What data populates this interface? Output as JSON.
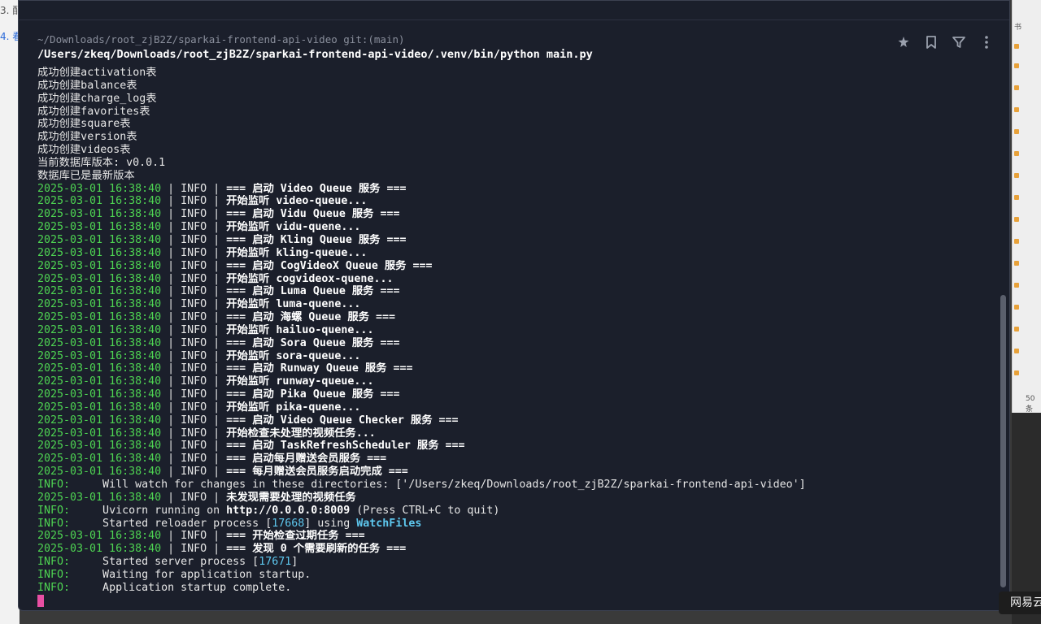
{
  "background": {
    "left_lines": [
      {
        "text": "3. 配",
        "style": "gray"
      },
      {
        "text": "4. 看",
        "style": "blue"
      }
    ],
    "right_top": "书",
    "right_pager": "50条",
    "toast": "网易云"
  },
  "terminal": {
    "prompt_path": "~/Downloads/root_zjB2Z/sparkai-frontend-api-video git:(main)",
    "command": "/Users/zkeq/Downloads/root_zjB2Z/sparkai-frontend-api-video/.venv/bin/python main.py",
    "toolbar": {
      "pin_icon": "pin-icon",
      "bookmark_icon": "bookmark-icon",
      "filter_icon": "filter-icon",
      "more_icon": "more-vertical-icon"
    },
    "plain_lines": [
      "成功创建activation表",
      "成功创建balance表",
      "成功创建charge_log表",
      "成功创建favorites表",
      "成功创建square表",
      "成功创建version表",
      "成功创建videos表",
      "当前数据库版本: v0.0.1",
      "数据库已是最新版本"
    ],
    "timestamp": "2025-03-01 16:38:40",
    "sep": " | INFO | ",
    "log_messages": [
      "=== 启动 Video Queue 服务 ===",
      "开始监听 video-queue...",
      "=== 启动 Vidu Queue 服务 ===",
      "开始监听 vidu-quene...",
      "=== 启动 Kling Queue 服务 ===",
      "开始监听 kling-queue...",
      "=== 启动 CogVideoX Queue 服务 ===",
      "开始监听 cogvideox-quene...",
      "=== 启动 Luma Queue 服务 ===",
      "开始监听 luma-quene...",
      "=== 启动 海螺 Queue 服务 ===",
      "开始监听 hailuo-quene...",
      "=== 启动 Sora Queue 服务 ===",
      "开始监听 sora-queue...",
      "=== 启动 Runway Queue 服务 ===",
      "开始监听 runway-queue...",
      "=== 启动 Pika Queue 服务 ===",
      "开始监听 pika-quene...",
      "=== 启动 Video Queue Checker 服务 ===",
      "开始检查未处理的视频任务...",
      "=== 启动 TaskRefreshScheduler 服务 ===",
      "=== 启动每月赠送会员服务 ===",
      "=== 每月赠送会员服务启动完成 ==="
    ],
    "info_label": "INFO:",
    "info_watch": "     Will watch for changes in these directories: ['/Users/zkeq/Downloads/root_zjB2Z/sparkai-frontend-api-video']",
    "log_no_task": "未发现需要处理的视频任务",
    "uvicorn_prefix": "     Uvicorn running on ",
    "uvicorn_url": "http://0.0.0.0:8009",
    "uvicorn_suffix": " (Press CTRL+C to quit)",
    "reloader_prefix": "     Started reloader process [",
    "reloader_pid": "17668",
    "reloader_mid": "] using ",
    "reloader_tool": "WatchFiles",
    "log_check_expired": "=== 开始检查过期任务 ===",
    "log_refresh": "=== 发现 0 个需要刷新的任务 ===",
    "server_prefix": "     Started server process [",
    "server_pid": "17671",
    "server_suffix": "]",
    "waiting": "     Waiting for application startup.",
    "complete": "     Application startup complete."
  },
  "colors": {
    "terminal_bg": "#1b1f2b",
    "timestamp_green": "#4ed452",
    "highlight_cyan": "#5ec8ef",
    "cursor_pink": "#e84fa3"
  }
}
